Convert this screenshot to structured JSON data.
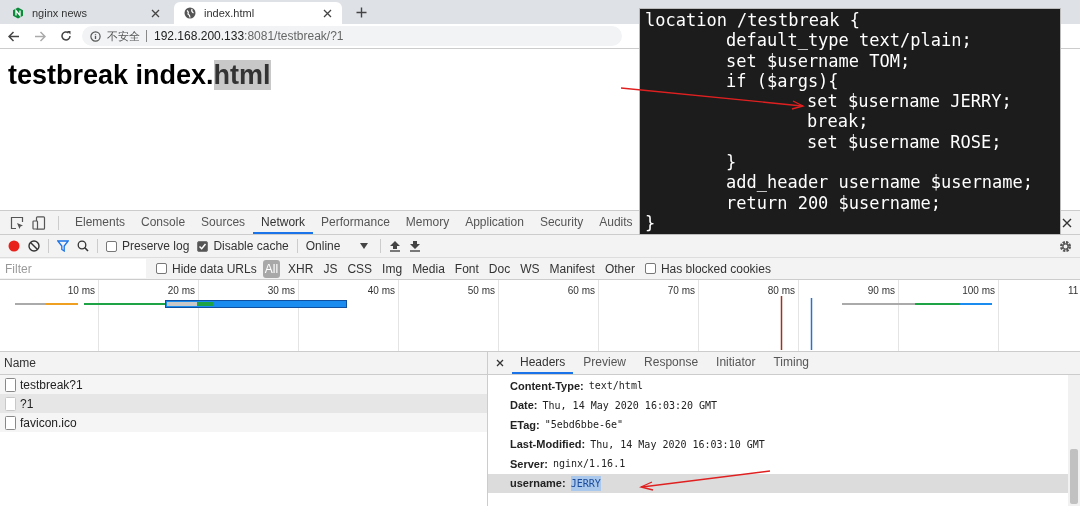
{
  "browser_tabs": [
    {
      "title": "nginx news",
      "selected": false
    },
    {
      "title": "index.html",
      "selected": true
    }
  ],
  "address_bar": {
    "security_label": "不安全",
    "host": "192.168.200.133",
    "path": ":8081/testbreak/?1"
  },
  "page": {
    "heading": "testbreak index.",
    "heading_selected": "html"
  },
  "code_overlay": {
    "lines": [
      {
        "text": "location /testbreak {",
        "children": [
          {
            "text": "default_type text/plain;"
          },
          {
            "text": "set $username TOM;"
          },
          {
            "text": "if ($args){",
            "children": [
              {
                "text": "set $username JERRY;"
              },
              {
                "text": "break;"
              },
              {
                "text": "set $username ROSE;"
              }
            ]
          },
          {
            "text": "}"
          },
          {
            "text": "add_header username $username;"
          },
          {
            "text": "return 200 $username;"
          }
        ]
      },
      {
        "text": "}"
      }
    ]
  },
  "devtools": {
    "tabs": [
      {
        "label": "Elements",
        "selected": false
      },
      {
        "label": "Console",
        "selected": false
      },
      {
        "label": "Sources",
        "selected": false
      },
      {
        "label": "Network",
        "selected": true
      },
      {
        "label": "Performance",
        "selected": false
      },
      {
        "label": "Memory",
        "selected": false
      },
      {
        "label": "Application",
        "selected": false
      },
      {
        "label": "Security",
        "selected": false
      },
      {
        "label": "Audits",
        "selected": false
      }
    ],
    "toolbar": {
      "recording": true,
      "preserve_log": {
        "label": "Preserve log",
        "checked": false
      },
      "disable_cache": {
        "label": "Disable cache",
        "checked": true
      },
      "throttling": "Online"
    },
    "filter_bar": {
      "placeholder": "Filter",
      "hide_data_urls": {
        "label": "Hide data URLs",
        "checked": false
      },
      "types": [
        {
          "label": "All",
          "selected": true
        },
        {
          "label": "XHR",
          "selected": false
        },
        {
          "label": "JS",
          "selected": false
        },
        {
          "label": "CSS",
          "selected": false
        },
        {
          "label": "Img",
          "selected": false
        },
        {
          "label": "Media",
          "selected": false
        },
        {
          "label": "Font",
          "selected": false
        },
        {
          "label": "Doc",
          "selected": false
        },
        {
          "label": "WS",
          "selected": false
        },
        {
          "label": "Manifest",
          "selected": false
        },
        {
          "label": "Other",
          "selected": false
        }
      ],
      "has_blocked_cookies": {
        "label": "Has blocked cookies",
        "checked": false
      }
    },
    "timeline": {
      "ticks": [
        "10 ms",
        "20 ms",
        "30 ms",
        "40 ms",
        "50 ms",
        "60 ms",
        "70 ms",
        "80 ms",
        "90 ms",
        "100 ms",
        "11"
      ]
    },
    "requests": {
      "column": "Name",
      "rows": [
        {
          "name": "testbreak?1",
          "selected": false
        },
        {
          "name": "?1",
          "selected": true
        },
        {
          "name": "favicon.ico",
          "selected": false
        }
      ]
    },
    "details": {
      "tabs": [
        {
          "label": "Headers",
          "selected": true
        },
        {
          "label": "Preview",
          "selected": false
        },
        {
          "label": "Response",
          "selected": false
        },
        {
          "label": "Initiator",
          "selected": false
        },
        {
          "label": "Timing",
          "selected": false
        }
      ],
      "headers": [
        {
          "name": "Content-Type:",
          "value": "text/html",
          "highlighted": false
        },
        {
          "name": "Date:",
          "value": "Thu, 14 May 2020 16:03:20 GMT",
          "highlighted": false
        },
        {
          "name": "ETag:",
          "value": "\"5ebd6bbe-6e\"",
          "highlighted": false
        },
        {
          "name": "Last-Modified:",
          "value": "Thu, 14 May 2020 16:03:10 GMT",
          "highlighted": false
        },
        {
          "name": "Server:",
          "value": "nginx/1.16.1",
          "highlighted": false
        },
        {
          "name": "username:",
          "value": "JERRY",
          "highlighted": true
        }
      ]
    }
  }
}
